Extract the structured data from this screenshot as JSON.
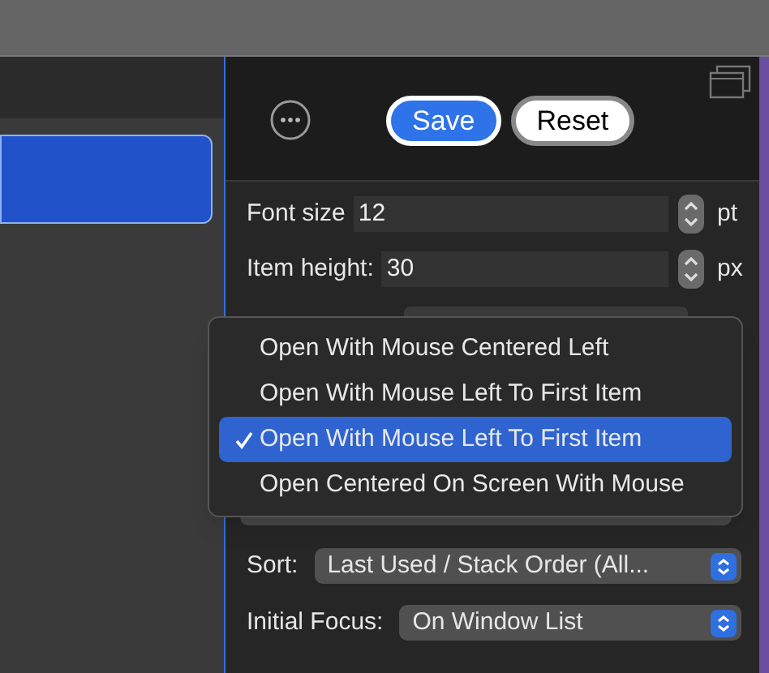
{
  "toolbar": {
    "buttons": [
      {
        "label": "Save",
        "kind": "primary"
      },
      {
        "label": "Reset",
        "kind": "default"
      }
    ]
  },
  "fields": [
    {
      "label": "Font size",
      "value": "12",
      "unit": "pt"
    },
    {
      "label": "Item height:",
      "value": "30",
      "unit": "px"
    }
  ],
  "menu": {
    "items": [
      {
        "label": "Open With Mouse Centered Left",
        "selected": false
      },
      {
        "label": "Open With Mouse Left To First Item",
        "selected": false
      },
      {
        "label": "Open With Mouse Left To First Item",
        "selected": true
      },
      {
        "label": "Open Centered On Screen With Mouse",
        "selected": false
      }
    ]
  },
  "selects": [
    {
      "label": "Sort:",
      "value": "Last Used / Stack Order (All..."
    },
    {
      "label": "Initial Focus:",
      "value": "On Window List"
    }
  ]
}
